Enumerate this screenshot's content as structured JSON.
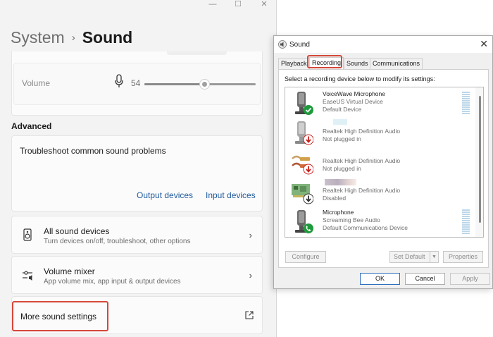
{
  "settings": {
    "breadcrumb_parent": "System",
    "breadcrumb_separator": "›",
    "page_title": "Sound",
    "window_controls": [
      "—",
      "☐",
      "✕"
    ],
    "volume": {
      "label": "Volume",
      "value": "54",
      "level": 54
    },
    "advanced_heading": "Advanced",
    "troubleshoot": {
      "title": "Troubleshoot common sound problems",
      "output_link": "Output devices",
      "input_link": "Input devices"
    },
    "all_sound_devices": {
      "title": "All sound devices",
      "subtitle": "Turn devices on/off, troubleshoot, other options"
    },
    "volume_mixer": {
      "title": "Volume mixer",
      "subtitle": "App volume mix, app input & output devices"
    },
    "more_sound_settings": "More sound settings"
  },
  "dialog": {
    "title": "Sound",
    "close": "✕",
    "tabs": [
      "Playback",
      "Recording",
      "Sounds",
      "Communications"
    ],
    "active_tab": "Recording",
    "instruction": "Select a recording device below to modify its settings:",
    "devices": [
      {
        "name": "VoiceWave Microphone",
        "description": "EaseUS Virtual Device",
        "state": "Default Device",
        "status": "default"
      },
      {
        "name": "",
        "description": "Realtek High Definition Audio",
        "state": "Not plugged in",
        "status": "unplugged"
      },
      {
        "name": "",
        "description": "Realtek High Definition Audio",
        "state": "Not plugged in",
        "status": "unplugged"
      },
      {
        "name": "",
        "description": "Realtek High Definition Audio",
        "state": "Disabled",
        "status": "disabled"
      },
      {
        "name": "Microphone",
        "description": "Screaming Bee Audio",
        "state": "Default Communications Device",
        "status": "communications"
      }
    ],
    "buttons": {
      "configure": "Configure",
      "set_default": "Set Default",
      "set_default_arrow": "▼",
      "properties": "Properties",
      "ok": "OK",
      "cancel": "Cancel",
      "apply": "Apply"
    }
  },
  "colors": {
    "highlight": "#d4483a",
    "link": "#1f5a9c",
    "ok_green": "#1e9a3c",
    "unplugged_red": "#c8201c"
  }
}
